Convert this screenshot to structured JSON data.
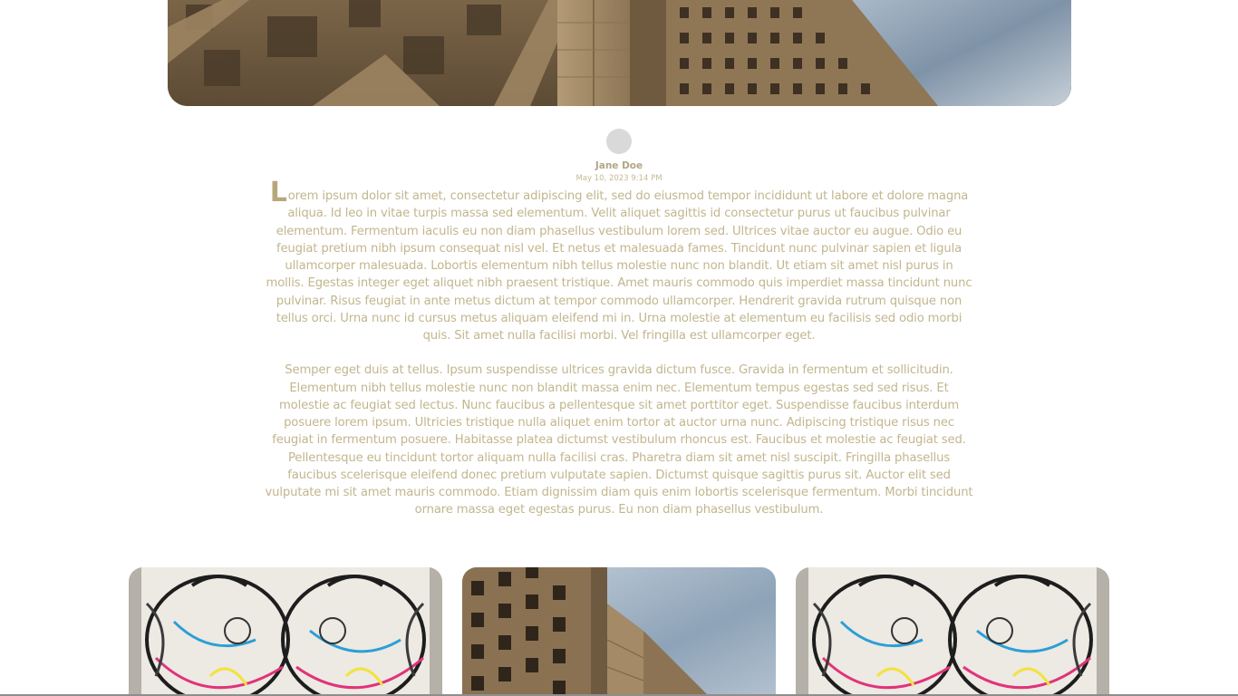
{
  "author": {
    "name": "Jane Doe",
    "date": "May 10, 2023 9:14 PM"
  },
  "article": {
    "dropcap": "L",
    "paragraph1": "orem ipsum dolor sit amet, consectetur adipiscing elit, sed do eiusmod tempor incididunt ut labore et dolore magna aliqua. Id leo in vitae turpis massa sed elementum. Velit aliquet sagittis id consectetur purus ut faucibus pulvinar elementum. Fermentum iaculis eu non diam phasellus vestibulum lorem sed. Ultrices vitae auctor eu augue. Odio eu feugiat pretium nibh ipsum consequat nisl vel. Et netus et malesuada fames. Tincidunt nunc pulvinar sapien et ligula ullamcorper malesuada. Lobortis elementum nibh tellus molestie nunc non blandit. Ut etiam sit amet nisl purus in mollis. Egestas integer eget aliquet nibh praesent tristique. Amet mauris commodo quis imperdiet massa tincidunt nunc pulvinar. Risus feugiat in ante metus dictum at tempor commodo ullamcorper. Hendrerit gravida rutrum quisque non tellus orci. Urna nunc id cursus metus aliquam eleifend mi in. Urna molestie at elementum eu facilisis sed odio morbi quis. Sit amet nulla facilisi morbi. Vel fringilla est ullamcorper eget.",
    "paragraph2": "Semper eget duis at tellus. Ipsum suspendisse ultrices gravida dictum fusce. Gravida in fermentum et sollicitudin. Elementum nibh tellus molestie nunc non blandit massa enim nec. Elementum tempus egestas sed sed risus. Et molestie ac feugiat sed lectus. Nunc faucibus a pellentesque sit amet porttitor eget. Suspendisse faucibus interdum posuere lorem ipsum. Ultricies tristique nulla aliquet enim tortor at auctor urna nunc. Adipiscing tristique risus nec feugiat in fermentum posuere. Habitasse platea dictumst vestibulum rhoncus est. Faucibus et molestie ac feugiat sed. Pellentesque eu tincidunt tortor aliquam nulla facilisi cras. Pharetra diam sit amet nisl suscipit. Fringilla phasellus faucibus scelerisque eleifend donec pretium vulputate sapien. Dictumst quisque sagittis purus sit. Auctor elit sed vulputate mi sit amet mauris commodo. Etiam dignissim diam quis enim lobortis scelerisque fermentum. Morbi tincidunt ornare massa eget egestas purus. Eu non diam phasellus vestibulum."
  },
  "colors": {
    "text": "#c2b68e",
    "accent": "#b7a77a",
    "avatar": "#d9d9d9"
  }
}
